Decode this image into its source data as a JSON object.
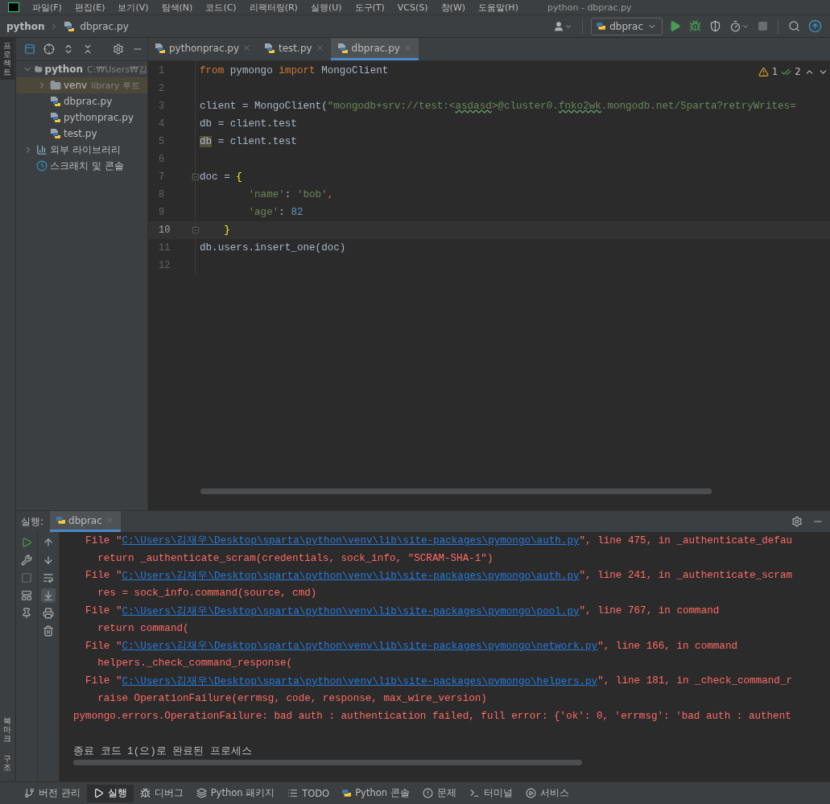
{
  "menu_bar": {
    "items": [
      "파일(F)",
      "편집(E)",
      "보기(V)",
      "탐색(N)",
      "코드(C)",
      "리팩터링(R)",
      "실행(U)",
      "도구(T)",
      "VCS(S)",
      "창(W)",
      "도움말(H)"
    ],
    "title": "python - dbprac.py"
  },
  "navigation_bar": {
    "breadcrumbs": [
      "python",
      "dbprac.py"
    ],
    "run_config": "dbprac"
  },
  "tool_strip": {
    "top": [
      {
        "label": "프로젝트",
        "selected": true
      }
    ],
    "bottom": [
      {
        "label": "북마크",
        "selected": false
      },
      {
        "label": "구조",
        "selected": false
      }
    ]
  },
  "project_panel": {
    "tree": [
      {
        "label": "python",
        "detail": "C:₩Users₩김",
        "kind": "folder",
        "expanded": true,
        "selected": false,
        "children": [
          {
            "label": "venv",
            "detail": "library 루트",
            "kind": "folder",
            "expanded": false,
            "selected": true
          },
          {
            "label": "dbprac.py",
            "kind": "python",
            "selected": false
          },
          {
            "label": "pythonprac.py",
            "kind": "python",
            "selected": false
          },
          {
            "label": "test.py",
            "kind": "python",
            "selected": false
          }
        ]
      },
      {
        "label": "외부 라이브러리",
        "kind": "library",
        "expanded": false,
        "selected": false
      },
      {
        "label": "스크래치 및 콘솔",
        "kind": "scratch",
        "selected": false
      }
    ]
  },
  "editor": {
    "tabs": [
      {
        "label": "pythonprac.py",
        "selected": false
      },
      {
        "label": "test.py",
        "selected": false
      },
      {
        "label": "dbprac.py",
        "selected": true
      }
    ],
    "inspections": {
      "warnings": "1",
      "typos": "2"
    },
    "lines": [
      {
        "number": "1",
        "current": false,
        "fold": false,
        "tokens": [
          {
            "kind": "keyword",
            "text": "from"
          },
          {
            "kind": "plain",
            "text": " pymongo "
          },
          {
            "kind": "keyword",
            "text": "import"
          },
          {
            "kind": "plain",
            "text": " MongoClient"
          }
        ]
      },
      {
        "number": "2",
        "current": false,
        "fold": false
      },
      {
        "number": "3",
        "current": false,
        "fold": false,
        "tokens": [
          {
            "kind": "plain",
            "text": "client = MongoClient("
          },
          {
            "kind": "string",
            "text": "\"mongodb+srv://test:<"
          },
          {
            "kind": "typo",
            "text": "asdasd"
          },
          {
            "kind": "string",
            "text": ">@cluster0."
          },
          {
            "kind": "typo",
            "text": "fnko2wk"
          },
          {
            "kind": "string",
            "text": ".mongodb.net/Sparta?retryWrites="
          }
        ]
      },
      {
        "number": "4",
        "current": false,
        "fold": false,
        "tokens": [
          {
            "kind": "plain",
            "text": "db = client.test"
          }
        ]
      },
      {
        "number": "5",
        "current": false,
        "fold": false,
        "tokens": [
          {
            "kind": "usage",
            "text": "db"
          },
          {
            "kind": "plain",
            "text": " = client.test"
          }
        ]
      },
      {
        "number": "6",
        "current": false,
        "fold": false
      },
      {
        "number": "7",
        "current": false,
        "fold": true,
        "tokens": [
          {
            "kind": "plain",
            "text": "doc = "
          },
          {
            "kind": "brace",
            "text": "{"
          }
        ]
      },
      {
        "number": "8",
        "current": false,
        "fold": false,
        "tokens": [
          {
            "kind": "string",
            "text": "        'name'"
          },
          {
            "kind": "plain",
            "text": ": "
          },
          {
            "kind": "string",
            "text": "'bob'"
          },
          {
            "kind": "keyword",
            "text": ","
          }
        ]
      },
      {
        "number": "9",
        "current": false,
        "fold": false,
        "tokens": [
          {
            "kind": "string",
            "text": "        'age'"
          },
          {
            "kind": "plain",
            "text": ": "
          },
          {
            "kind": "number",
            "text": "82"
          }
        ]
      },
      {
        "number": "10",
        "current": true,
        "fold": true,
        "tokens": [
          {
            "kind": "brace",
            "text": "    }"
          }
        ]
      },
      {
        "number": "11",
        "current": false,
        "fold": false,
        "tokens": [
          {
            "kind": "plain",
            "text": "db.users.insert_one(doc)"
          }
        ]
      },
      {
        "number": "12",
        "current": false,
        "fold": false
      }
    ]
  },
  "run_panel": {
    "label": "실행:",
    "tabs": [
      {
        "label": "dbprac",
        "selected": true
      }
    ],
    "actions": [
      {
        "kind": "rerun",
        "disabled": false
      },
      {
        "kind": "settings",
        "disabled": false
      },
      {
        "kind": "stop",
        "disabled": true
      },
      {
        "kind": "layout",
        "disabled": false
      },
      {
        "kind": "pin",
        "disabled": false
      }
    ],
    "toolbar": [
      {
        "kind": "up",
        "selected": false
      },
      {
        "kind": "down",
        "selected": false
      },
      {
        "kind": "wrap",
        "selected": false
      },
      {
        "kind": "scroll-end",
        "selected": true
      },
      {
        "kind": "print",
        "selected": false
      },
      {
        "kind": "clear",
        "selected": false
      }
    ],
    "lines": [
      {
        "kind": "error",
        "parts": [
          {
            "kind": "text",
            "text": "  File \""
          },
          {
            "kind": "link",
            "text": "C:\\Users\\김재우\\Desktop\\sparta\\python\\venv\\lib\\site-packages\\pymongo\\auth.py"
          },
          {
            "kind": "text",
            "text": "\", line 475, in _authenticate_defau"
          }
        ]
      },
      {
        "kind": "error",
        "parts": [
          {
            "kind": "text",
            "text": "    return _authenticate_scram(credentials, sock_info, \"SCRAM-SHA-1\")"
          }
        ]
      },
      {
        "kind": "error",
        "parts": [
          {
            "kind": "text",
            "text": "  File \""
          },
          {
            "kind": "link",
            "text": "C:\\Users\\김재우\\Desktop\\sparta\\python\\venv\\lib\\site-packages\\pymongo\\auth.py"
          },
          {
            "kind": "text",
            "text": "\", line 241, in _authenticate_scram"
          }
        ]
      },
      {
        "kind": "error",
        "parts": [
          {
            "kind": "text",
            "text": "    res = sock_info.command(source, cmd)"
          }
        ]
      },
      {
        "kind": "error",
        "parts": [
          {
            "kind": "text",
            "text": "  File \""
          },
          {
            "kind": "link",
            "text": "C:\\Users\\김재우\\Desktop\\sparta\\python\\venv\\lib\\site-packages\\pymongo\\pool.py"
          },
          {
            "kind": "text",
            "text": "\", line 767, in command"
          }
        ]
      },
      {
        "kind": "error",
        "parts": [
          {
            "kind": "text",
            "text": "    return command("
          }
        ]
      },
      {
        "kind": "error",
        "parts": [
          {
            "kind": "text",
            "text": "  File \""
          },
          {
            "kind": "link",
            "text": "C:\\Users\\김재우\\Desktop\\sparta\\python\\venv\\lib\\site-packages\\pymongo\\network.py"
          },
          {
            "kind": "text",
            "text": "\", line 166, in command"
          }
        ]
      },
      {
        "kind": "error",
        "parts": [
          {
            "kind": "text",
            "text": "    helpers._check_command_response("
          }
        ]
      },
      {
        "kind": "error",
        "parts": [
          {
            "kind": "text",
            "text": "  File \""
          },
          {
            "kind": "link",
            "text": "C:\\Users\\김재우\\Desktop\\sparta\\python\\venv\\lib\\site-packages\\pymongo\\helpers.py"
          },
          {
            "kind": "text",
            "text": "\", line 181, in _check_command_r"
          }
        ]
      },
      {
        "kind": "error",
        "parts": [
          {
            "kind": "text",
            "text": "    raise OperationFailure(errmsg, code, response, max_wire_version)"
          }
        ]
      },
      {
        "kind": "error",
        "parts": [
          {
            "kind": "text",
            "text": "pymongo.errors.OperationFailure: bad auth : authentication failed, full error: {'ok': 0, 'errmsg': 'bad auth : authent"
          }
        ]
      },
      {
        "kind": "blank"
      },
      {
        "kind": "plain",
        "parts": [
          {
            "kind": "text",
            "text": "종료 코드 1(으)로 완료된 프로세스"
          }
        ]
      }
    ]
  },
  "bottom_bar": [
    {
      "kind": "vcs",
      "label": "버전 관리",
      "selected": false
    },
    {
      "kind": "run",
      "label": "실행",
      "selected": true
    },
    {
      "kind": "debug",
      "label": "디버그",
      "selected": false
    },
    {
      "kind": "packages",
      "label": "Python 패키지",
      "selected": false
    },
    {
      "kind": "todo",
      "label": "TODO",
      "selected": false
    },
    {
      "kind": "console",
      "label": "Python 콘솔",
      "selected": false
    },
    {
      "kind": "problems",
      "label": "문제",
      "selected": false
    },
    {
      "kind": "terminal",
      "label": "터미널",
      "selected": false
    },
    {
      "kind": "services",
      "label": "서비스",
      "selected": false
    }
  ]
}
